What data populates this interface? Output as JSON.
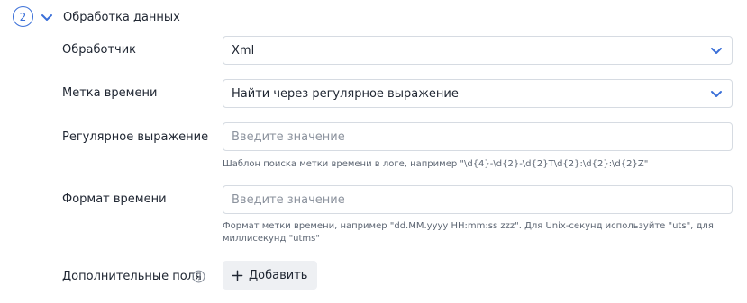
{
  "step": {
    "number": "2",
    "title": "Обработка данных"
  },
  "processor": {
    "label": "Обработчик",
    "value": "Xml"
  },
  "timestamp": {
    "label": "Метка времени",
    "value": "Найти через регулярное выражение"
  },
  "regex": {
    "label": "Регулярное выражение",
    "placeholder": "Введите значение",
    "hint": "Шаблон поиска метки времени в логе, например \"\\d{4}-\\d{2}-\\d{2}T\\d{2}:\\d{2}:\\d{2}Z\""
  },
  "time_format": {
    "label": "Формат времени",
    "placeholder": "Введите значение",
    "hint_line1": "Формат метки времени, например \"dd.MM.yyyy HH:mm:ss zzz\". Для Unix-секунд используйте \"uts\", для",
    "hint_line2": "миллисекунд \"utms\""
  },
  "extra_fields": {
    "label": "Дополнительные поля",
    "add_label": "Добавить"
  },
  "icons": {
    "section_toggle": "chevron-down-icon",
    "select_arrow": "chevron-down-icon",
    "help": "question-circle-icon",
    "add": "plus-icon"
  },
  "colors": {
    "accent": "#3a6fd8",
    "border": "#d6dbe2",
    "placeholder": "#8c939e",
    "hint": "#5d6673",
    "button_bg": "#eef0f3"
  }
}
